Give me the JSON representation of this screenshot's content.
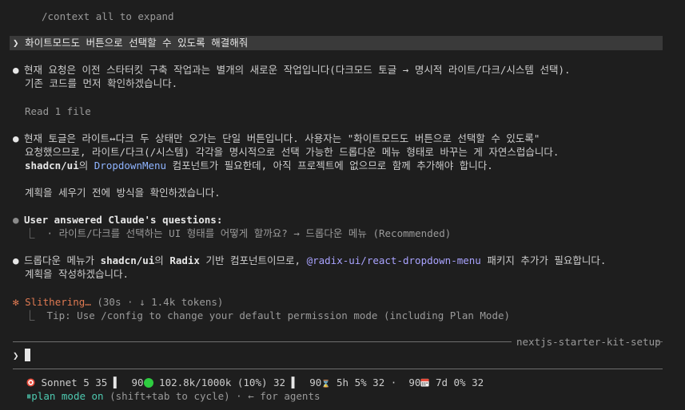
{
  "collapsed_hint": "/context all to expand",
  "user_prompt": {
    "chevron": "❯",
    "text": "화이트모드도 버튼으로 선택할 수 있도록 해결해줘"
  },
  "messages": {
    "m1_line1": "현재 요청은 이전 스타터킷 구축 작업과는 별개의 새로운 작업입니다(다크모드 토글 → 명시적 라이트/다크/시스템 선택).",
    "m1_line2": "기존 코드를 먼저 확인하겠습니다.",
    "read_file": "Read 1 file",
    "m2_line1": "현재 토글은 라이트↔다크 두 상태만 오가는 단일 버튼입니다. 사용자는 \"화이트모드도 버튼으로 선택할 수 있도록\"",
    "m2_line2": "요청했으므로, 라이트/다크(/시스템) 각각을 명시적으로 선택 가능한 드롭다운 메뉴 형태로 바꾸는 게 자연스럽습니다.",
    "m2_line3_a": "shadcn/ui",
    "m2_line3_b": "의 ",
    "m2_line3_c": "DropdownMenu",
    "m2_line3_d": " 컴포넌트가 필요한데, 아직 프로젝트에 없으므로 함께 추가해야 합니다.",
    "m2_line4": "계획을 세우기 전에 방식을 확인하겠습니다.",
    "answered_title": "User answered Claude's questions:",
    "answered_detail": "⎿  · 라이트/다크를 선택하는 UI 형태를 어떻게 할까요? → 드롭다운 메뉴 (Recommended)",
    "m3_line1_a": "드롭다운 메뉴가 ",
    "m3_line1_b": "shadcn/ui",
    "m3_line1_c": "의 ",
    "m3_line1_d": "Radix",
    "m3_line1_e": " 기반 컴포넌트이므로, ",
    "m3_line1_f": "@radix-ui/react-dropdown-menu",
    "m3_line1_g": " 패키지 추가가 필요합니다.",
    "m3_line2": "계획을 작성하겠습니다."
  },
  "status": {
    "spinner": "✻",
    "verb": "Slithering…",
    "detail": " (30s · ↓ 1.4k tokens)",
    "tip": "⎿  Tip: Use /config to change your default permission mode (including Plan Mode)"
  },
  "input": {
    "session_label": "nextjs-starter-kit-setup",
    "prompt_chevron": "❯"
  },
  "statusline": {
    "model_icon": "target-icon",
    "model": "Sonnet 5 35",
    "ctx_prefix": "90",
    "ctx_value": "102.8k/1000k (10%) 32",
    "five_h_prefix": "90",
    "five_h": "5h 5% 32 ·",
    "seven_d_prefix": "90",
    "seven_d": "7d 0% 32",
    "mode_icon": "⏸",
    "mode_label": "plan mode on",
    "mode_hint": " (shift+tab to cycle) · ← for agents",
    "colors": {
      "green": "#2ecc40",
      "mode": "#4ec9b0",
      "accent_orange": "#e07a52",
      "link_purple": "#a9a3ff"
    }
  }
}
